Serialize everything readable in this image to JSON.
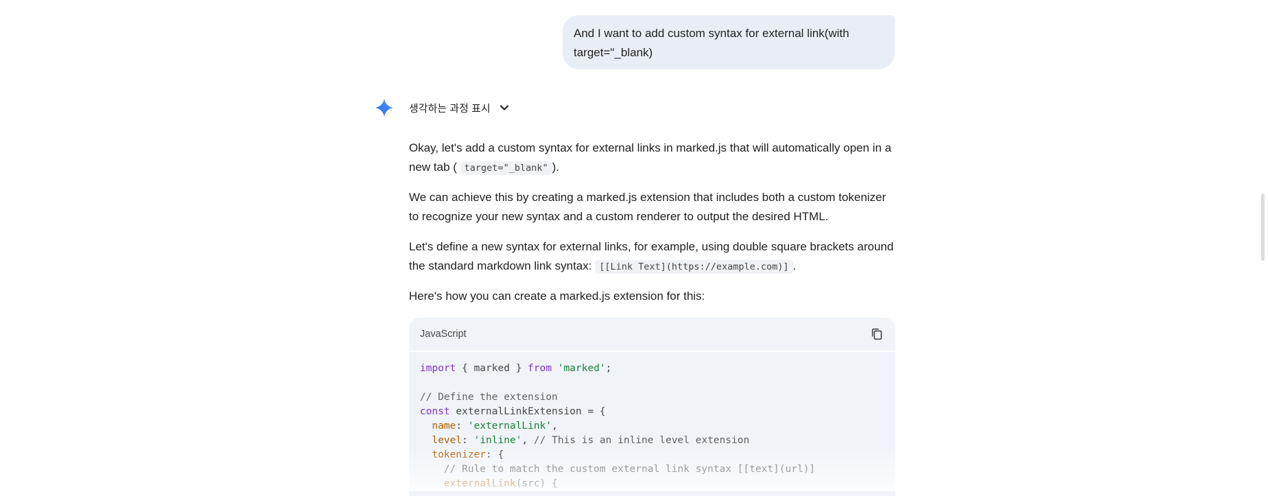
{
  "user_message": {
    "line1": "And I want to add custom syntax for external link(with",
    "line2": "target=\"_blank)"
  },
  "thinking": {
    "label": "생각하는 과정 표시",
    "icon": "chevron-down-icon"
  },
  "response": {
    "p1_text": "Okay, let's add a custom syntax for external links in marked.js that will automatically open in a new tab (",
    "p1_code": "target=\"_blank\"",
    "p1_end": ").",
    "p2": "We can achieve this by creating a marked.js extension that includes both a custom tokenizer to recognize your new syntax and a custom renderer to output the desired HTML.",
    "p3_text": "Let's define a new syntax for external links, for example, using double square brackets around the standard markdown link syntax: ",
    "p3_code": "[[Link Text](https://example.com)]",
    "p3_end": ".",
    "p4": "Here's how you can create a marked.js extension for this:"
  },
  "code_block": {
    "language": "JavaScript",
    "copy_icon": "copy-icon",
    "lines": {
      "l1_kw": "import",
      "l1_a": " { marked } ",
      "l1_kw2": "from",
      "l1_b": " ",
      "l1_str": "'marked'",
      "l1_c": ";",
      "l3": "// Define the extension",
      "l4_kw": "const",
      "l4_a": " externalLinkExtension = {",
      "l5_a": "  ",
      "l5_prop": "name",
      "l5_b": ": ",
      "l5_str": "'externalLink'",
      "l5_c": ",",
      "l6_a": "  ",
      "l6_prop": "level",
      "l6_b": ": ",
      "l6_str": "'inline'",
      "l6_c": ", ",
      "l6_cmt": "// This is an inline level extension",
      "l7_a": "  ",
      "l7_prop": "tokenizer",
      "l7_b": ": {",
      "l8": "    // Rule to match the custom external link syntax [[text](url)]",
      "l9_a": "    ",
      "l9_prop": "externalLink",
      "l9_b": "(src) {"
    }
  },
  "colors": {
    "user_bubble": "#e9eef6",
    "code_bg": "#f0f4f9",
    "keyword": "#8430ce",
    "string": "#188038",
    "property": "#b06000"
  }
}
